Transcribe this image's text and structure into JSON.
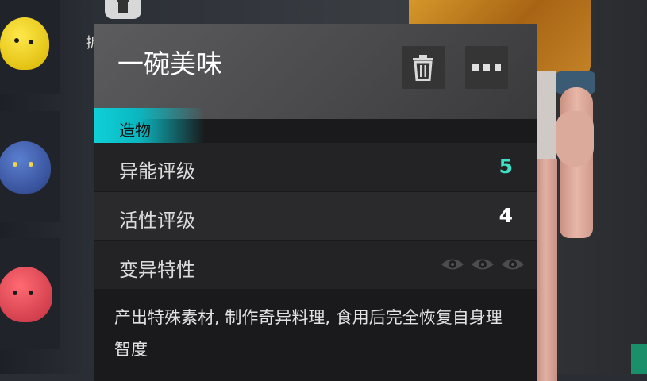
{
  "item": {
    "name": "一碗美味",
    "category": "造物",
    "description": "产出特殊素材, 制作奇异料理, 食用后完全恢复自身理智度"
  },
  "stats": [
    {
      "label": "异能评级",
      "value": "5",
      "color": "#3de0c4"
    },
    {
      "label": "活性评级",
      "value": "4",
      "color": "#ffffff"
    },
    {
      "label": "变异特性",
      "value": "",
      "color": "#ffffff"
    }
  ],
  "mutation_icons": [
    "eye-icon",
    "eye-icon",
    "eye-icon"
  ],
  "actions": {
    "delete_icon": "trash-icon",
    "more_icon": "more-icon"
  },
  "stray_text": "拆",
  "colors": {
    "accent": "#0fd0d8",
    "highlight_value": "#3de0c4"
  }
}
